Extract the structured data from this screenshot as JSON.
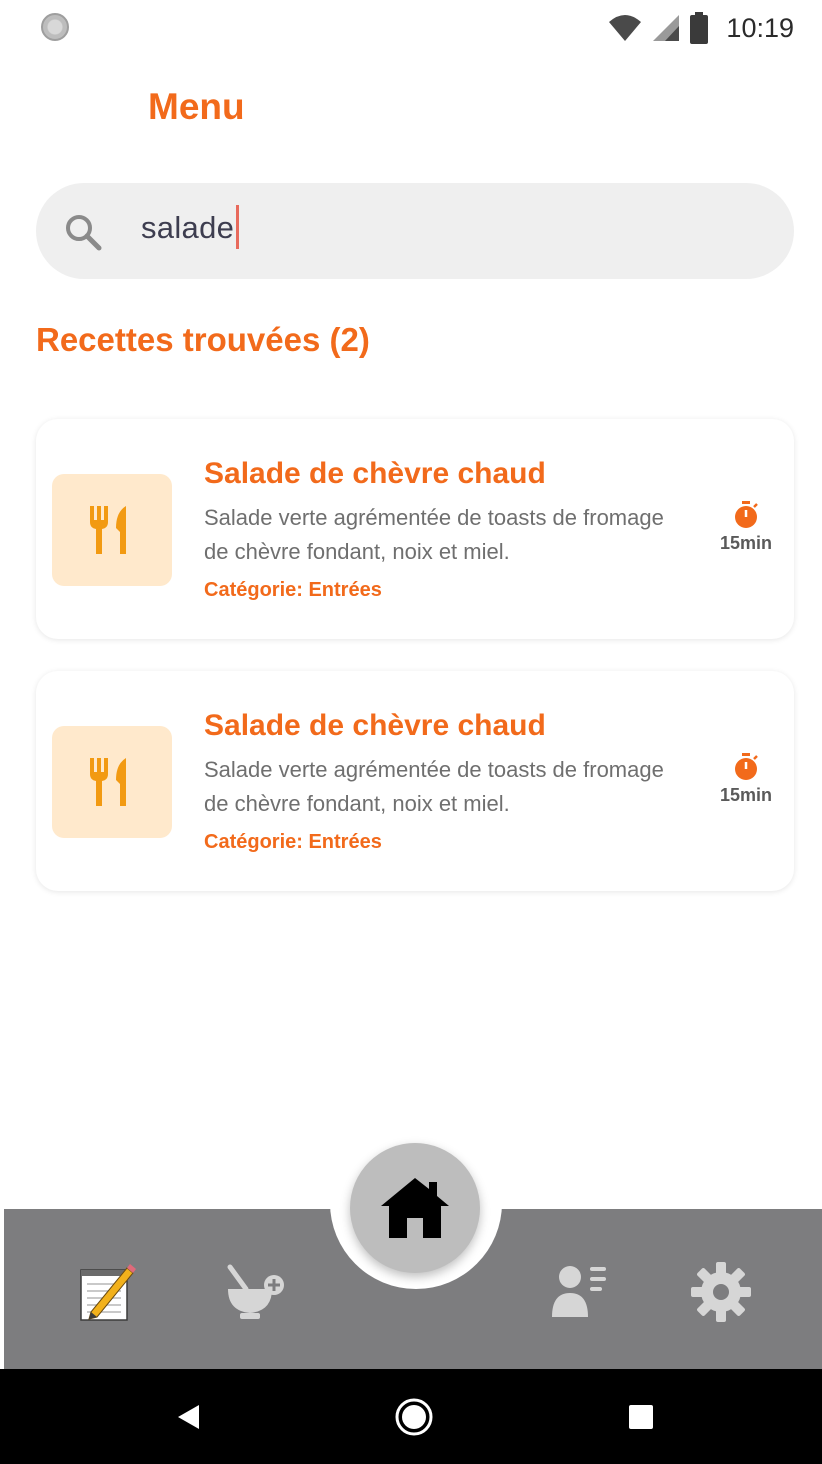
{
  "status_bar": {
    "time": "10:19"
  },
  "header": {
    "title": "Menu"
  },
  "search": {
    "value": "salade"
  },
  "results": {
    "title": "Recettes trouvées (2)"
  },
  "recipes": [
    {
      "title": "Salade de chèvre chaud",
      "description": "Salade verte agrémentée de toasts de fromage de chèvre fondant, noix et miel.",
      "category": "Catégorie: Entrées",
      "time": "15min"
    },
    {
      "title": "Salade de chèvre chaud",
      "description": "Salade verte agrémentée de toasts de fromage de chèvre fondant, noix et miel.",
      "category": "Catégorie: Entrées",
      "time": "15min"
    }
  ],
  "bottom_nav": {
    "items": [
      {
        "icon": "notepad-pencil-icon"
      },
      {
        "icon": "bowl-add-icon"
      },
      {
        "icon": "home-icon"
      },
      {
        "icon": "profile-list-icon"
      },
      {
        "icon": "gear-icon"
      }
    ]
  },
  "colors": {
    "accent": "#f26a1b",
    "thumb_bg": "#ffe9cc",
    "nav_bg": "#7d7d7f"
  }
}
